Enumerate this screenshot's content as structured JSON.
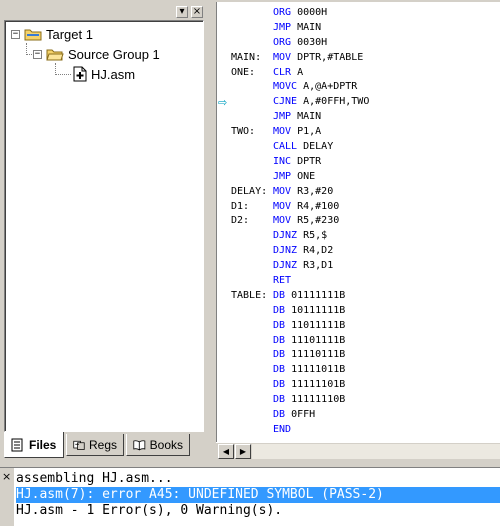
{
  "project": {
    "tree": {
      "root": "Target 1",
      "group": "Source Group 1",
      "file": "HJ.asm"
    },
    "tabs": [
      {
        "label": "Files",
        "icon": "files-icon"
      },
      {
        "label": "Regs",
        "icon": "regs-icon"
      },
      {
        "label": "Books",
        "icon": "books-icon"
      }
    ],
    "buttons": {
      "menu": "▾",
      "close": "×"
    }
  },
  "editor": {
    "lines": [
      {
        "label": "",
        "mnemonic": "ORG",
        "operands": "0000H"
      },
      {
        "label": "",
        "mnemonic": "JMP",
        "operands": "MAIN"
      },
      {
        "label": "",
        "mnemonic": "ORG",
        "operands": "0030H"
      },
      {
        "label": "MAIN:",
        "mnemonic": "MOV",
        "operands": "DPTR,#TABLE"
      },
      {
        "label": "ONE:",
        "mnemonic": "CLR",
        "operands": "A"
      },
      {
        "label": "",
        "mnemonic": "MOVC",
        "operands": "A,@A+DPTR"
      },
      {
        "label": "",
        "mnemonic": "CJNE",
        "operands": "A,#0FFH,TWO"
      },
      {
        "label": "",
        "mnemonic": "JMP",
        "operands": "MAIN"
      },
      {
        "label": "TWO:",
        "mnemonic": "MOV",
        "operands": "P1,A"
      },
      {
        "label": "",
        "mnemonic": "CALL",
        "operands": "DELAY"
      },
      {
        "label": "",
        "mnemonic": "INC",
        "operands": "DPTR"
      },
      {
        "label": "",
        "mnemonic": "JMP",
        "operands": "ONE"
      },
      {
        "label": "DELAY:",
        "mnemonic": "MOV",
        "operands": "R3,#20"
      },
      {
        "label": "D1:",
        "mnemonic": "MOV",
        "operands": "R4,#100"
      },
      {
        "label": "D2:",
        "mnemonic": "MOV",
        "operands": "R5,#230"
      },
      {
        "label": "",
        "mnemonic": "DJNZ",
        "operands": "R5,$"
      },
      {
        "label": "",
        "mnemonic": "DJNZ",
        "operands": "R4,D2"
      },
      {
        "label": "",
        "mnemonic": "DJNZ",
        "operands": "R3,D1"
      },
      {
        "label": "",
        "mnemonic": "RET",
        "operands": ""
      },
      {
        "label": "TABLE:",
        "mnemonic": "DB",
        "operands": "01111111B"
      },
      {
        "label": "",
        "mnemonic": "DB",
        "operands": "10111111B"
      },
      {
        "label": "",
        "mnemonic": "DB",
        "operands": "11011111B"
      },
      {
        "label": "",
        "mnemonic": "DB",
        "operands": "11101111B"
      },
      {
        "label": "",
        "mnemonic": "DB",
        "operands": "11110111B"
      },
      {
        "label": "",
        "mnemonic": "DB",
        "operands": "11111011B"
      },
      {
        "label": "",
        "mnemonic": "DB",
        "operands": "11111101B"
      },
      {
        "label": "",
        "mnemonic": "DB",
        "operands": "11111110B"
      },
      {
        "label": "",
        "mnemonic": "DB",
        "operands": "0FFH"
      },
      {
        "label": "",
        "mnemonic": "END",
        "operands": ""
      }
    ],
    "current_line_marker": "⇨",
    "scroll_left": "◀",
    "scroll_right": "▶"
  },
  "output": {
    "close": "×",
    "lines": [
      {
        "text": "assembling HJ.asm...",
        "selected": false
      },
      {
        "text": "HJ.asm(7): error A45: UNDEFINED SYMBOL (PASS-2)",
        "selected": true
      },
      {
        "text": "HJ.asm - 1 Error(s), 0 Warning(s).",
        "selected": false
      }
    ]
  },
  "colors": {
    "mnemonic": "#0000ff",
    "selection": "#3399ff",
    "arrow": "#00a0c0"
  }
}
